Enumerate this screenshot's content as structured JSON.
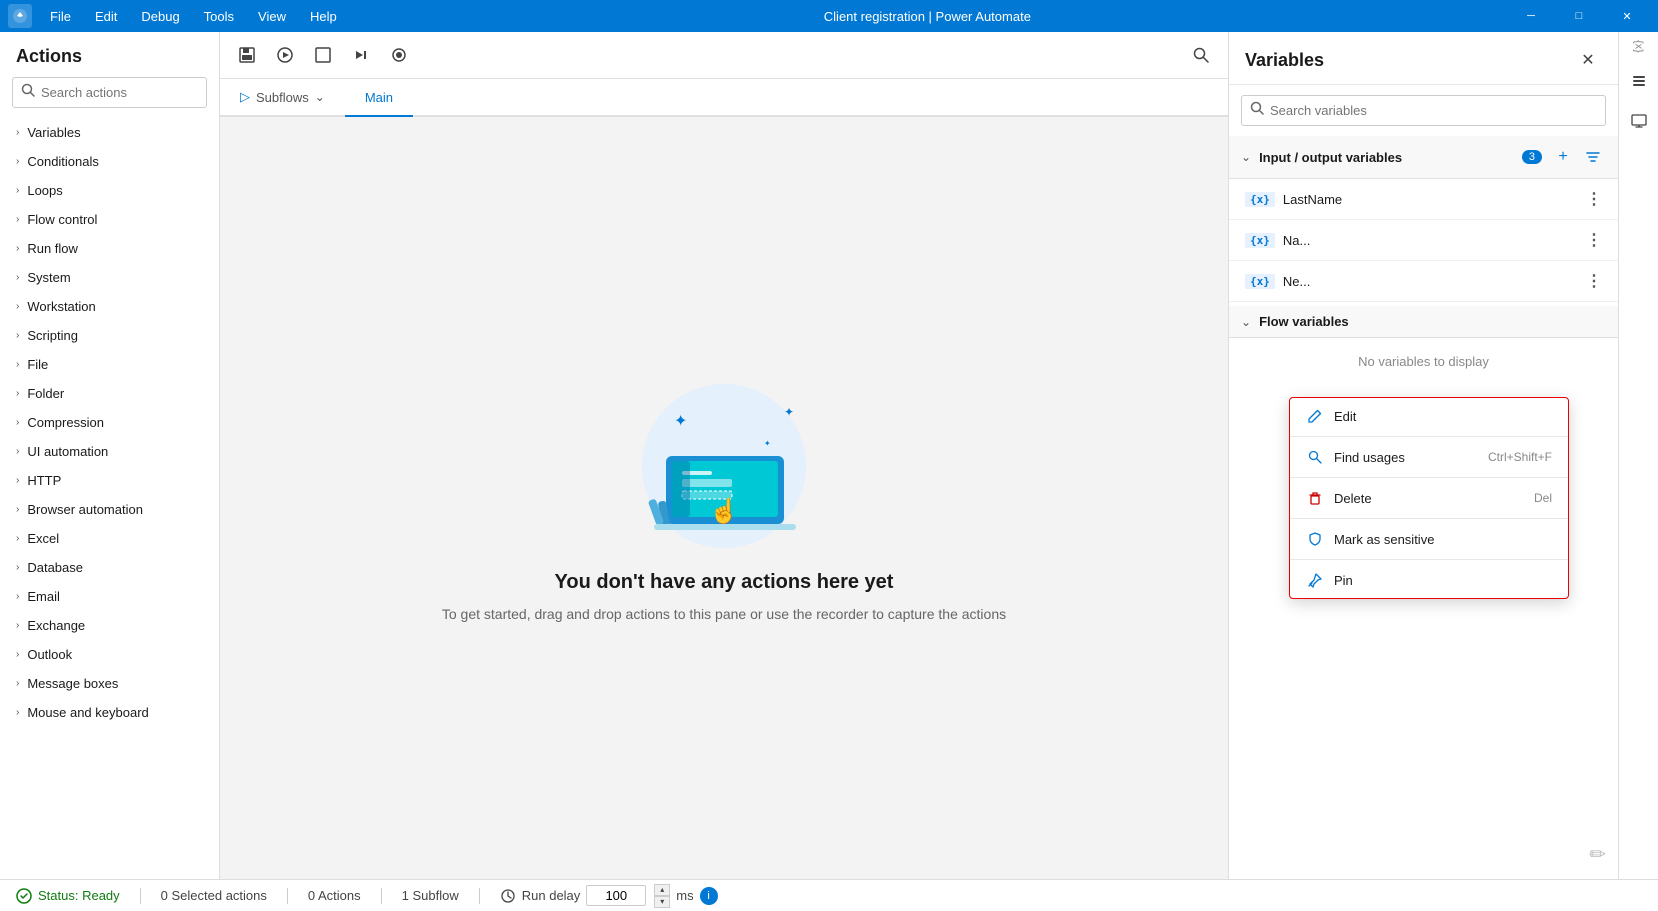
{
  "titlebar": {
    "menus": [
      "File",
      "Edit",
      "Debug",
      "Tools",
      "View",
      "Help"
    ],
    "title": "Client registration | Power Automate",
    "controls": [
      "minimize",
      "maximize",
      "close"
    ]
  },
  "actions_panel": {
    "title": "Actions",
    "search_placeholder": "Search actions",
    "items": [
      "Variables",
      "Conditionals",
      "Loops",
      "Flow control",
      "Run flow",
      "System",
      "Workstation",
      "Scripting",
      "File",
      "Folder",
      "Compression",
      "UI automation",
      "HTTP",
      "Browser automation",
      "Excel",
      "Database",
      "Email",
      "Exchange",
      "Outlook",
      "Message boxes",
      "Mouse and keyboard"
    ]
  },
  "toolbar": {
    "buttons": [
      "save",
      "run",
      "stop",
      "step",
      "record"
    ]
  },
  "tabs": {
    "subflows_label": "Subflows",
    "main_label": "Main"
  },
  "canvas": {
    "empty_title": "You don't have any actions here yet",
    "empty_subtitle": "To get started, drag and drop actions to this pane\nor use the recorder to capture the actions"
  },
  "variables_panel": {
    "title": "Variables",
    "search_placeholder": "Search variables",
    "input_output": {
      "label": "Input / output variables",
      "count": "3",
      "items": [
        {
          "name": "LastName",
          "tag": "{x}"
        },
        {
          "name": "Na...",
          "tag": "{x}"
        },
        {
          "name": "Ne...",
          "tag": "{x}"
        }
      ]
    },
    "flow_variables": {
      "label": "Flow variables",
      "no_vars_text": "No variables to display"
    }
  },
  "context_menu": {
    "items": [
      {
        "label": "Edit",
        "icon": "edit",
        "shortcut": ""
      },
      {
        "label": "Find usages",
        "icon": "search",
        "shortcut": "Ctrl+Shift+F"
      },
      {
        "label": "Delete",
        "icon": "delete",
        "shortcut": "Del"
      },
      {
        "label": "Mark as sensitive",
        "icon": "shield",
        "shortcut": ""
      },
      {
        "label": "Pin",
        "icon": "pin",
        "shortcut": ""
      }
    ]
  },
  "statusbar": {
    "status_label": "Status: Ready",
    "selected_actions": "0 Selected actions",
    "actions_count": "0 Actions",
    "subflow_count": "1 Subflow",
    "run_delay_label": "Run delay",
    "run_delay_value": "100",
    "run_delay_unit": "ms"
  }
}
